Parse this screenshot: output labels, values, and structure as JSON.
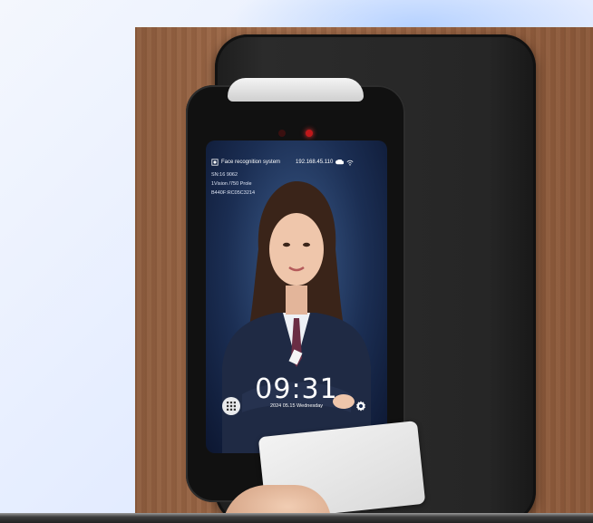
{
  "screen": {
    "app_title": "Face recognition system",
    "ip": "192.168.45.110",
    "info_lines": [
      "SN:16 9062",
      "1Vision /750 Prole",
      "B440F:RC05C3214"
    ],
    "time": "09:31",
    "date": "2024 05.15 Wednesday"
  },
  "icons": {
    "status": "face-icon",
    "cloud": "cloud-icon",
    "wifi": "wifi-icon",
    "menu": "grid-icon",
    "settings": "gear-icon"
  },
  "colors": {
    "screen_bg": "#1b2e53",
    "device_body": "#262626",
    "wood": "#9a6443",
    "indicator": "#c0181a"
  }
}
